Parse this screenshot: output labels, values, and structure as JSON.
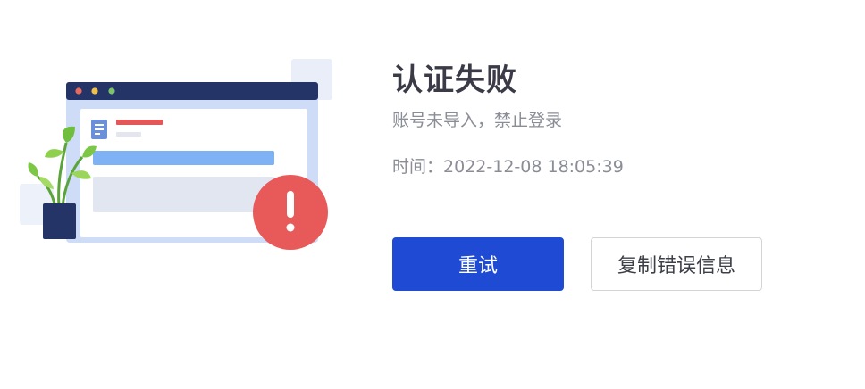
{
  "error": {
    "title": "认证失败",
    "message": "账号未导入，禁止登录",
    "time_label": "时间：",
    "time_value": "2022-12-08 18:05:39"
  },
  "actions": {
    "retry_label": "重试",
    "copy_label": "复制错误信息"
  },
  "colors": {
    "primary": "#1f4bd4",
    "alert": "#e85a5a",
    "window_header": "#243466"
  },
  "icons": {
    "illustration": "error-browser-window-illustration",
    "alert": "exclamation-icon",
    "plant": "potted-plant-icon"
  }
}
